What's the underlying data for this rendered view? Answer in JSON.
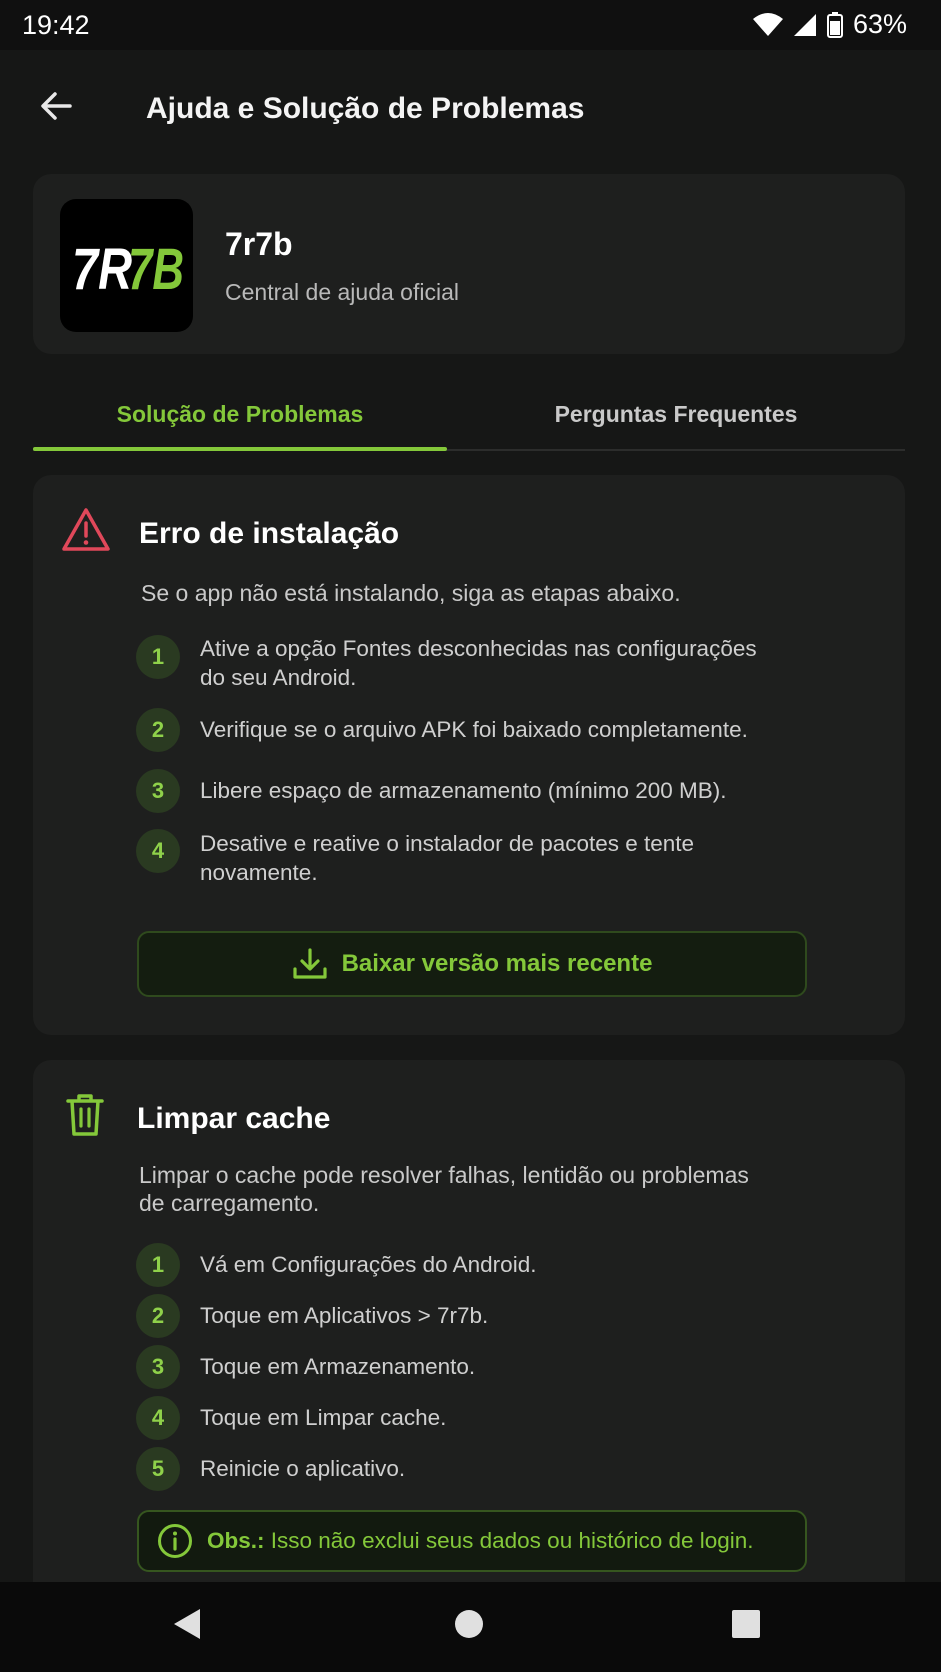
{
  "status_bar": {
    "time": "19:42",
    "battery": "63%"
  },
  "app_bar": {
    "title": "Ajuda e Solução de Problemas"
  },
  "app_card": {
    "name": "7r7b",
    "subtitle": "Central de ajuda oficial",
    "logo_text": "7R7B"
  },
  "tabs": [
    {
      "label": "Solução de Problemas",
      "active": true
    },
    {
      "label": "Perguntas Frequentes",
      "active": false
    }
  ],
  "install_error": {
    "title": "Erro de instalação",
    "description": "Se o app não está instalando, siga as etapas abaixo.",
    "steps": [
      {
        "num": "1",
        "text": "Ative a opção Fontes desconhecidas nas configurações do seu Android."
      },
      {
        "num": "2",
        "text": "Verifique se o arquivo APK foi baixado completamente."
      },
      {
        "num": "3",
        "text": "Libere espaço de armazenamento (mínimo 200 MB)."
      },
      {
        "num": "4",
        "text": "Desative e reative o instalador de pacotes e tente novamente."
      }
    ],
    "button_label": "Baixar versão mais recente"
  },
  "clear_cache": {
    "title": "Limpar cache",
    "description": "Limpar o cache pode resolver falhas, lentidão ou problemas de carregamento.",
    "steps": [
      {
        "num": "1",
        "text": "Vá em Configurações do Android."
      },
      {
        "num": "2",
        "text": "Toque em Aplicativos > 7r7b."
      },
      {
        "num": "3",
        "text": "Toque em Armazenamento."
      },
      {
        "num": "4",
        "text": "Toque em Limpar cache."
      },
      {
        "num": "5",
        "text": "Reinicie o aplicativo."
      }
    ],
    "note_label": "Obs.:",
    "note_text": " Isso não exclui seus dados ou histórico de login."
  },
  "colors": {
    "accent": "#84c83a",
    "warning": "#e0485a",
    "background": "#161716",
    "card": "#1e1f1e"
  },
  "icons": [
    "back-arrow-icon",
    "wifi-icon",
    "signal-icon",
    "battery-icon",
    "warning-triangle-icon",
    "download-icon",
    "trash-icon",
    "info-icon",
    "nav-back-icon",
    "nav-home-icon",
    "nav-recents-icon"
  ]
}
